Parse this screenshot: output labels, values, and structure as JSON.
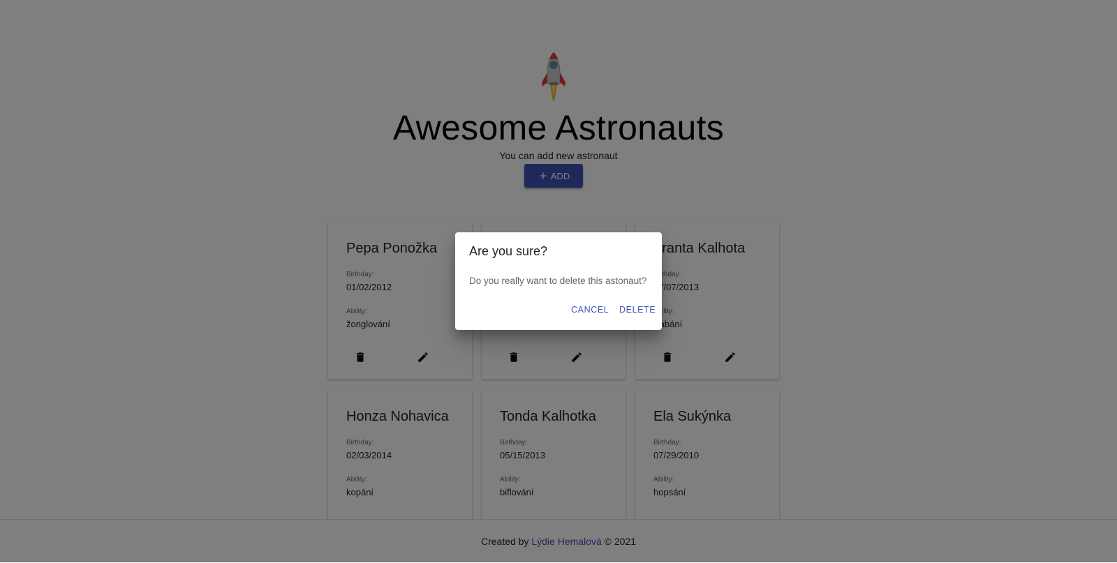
{
  "header": {
    "title": "Awesome Astronauts",
    "subtitle": "You can add new astronaut",
    "add_label": "ADD",
    "logo_icon": "rocket-icon",
    "add_icon": "plus-icon"
  },
  "astronauts": [
    {
      "name": "Pepa Ponožka",
      "birthday_label": "Birthday:",
      "birthday": "01/02/2012",
      "ability_label": "Ability:",
      "ability": "žonglování"
    },
    {
      "name": "",
      "birthday_label": "",
      "birthday": "",
      "ability_label": "",
      "ability": ""
    },
    {
      "name": "Franta Kalhota",
      "birthday_label": "Birthday:",
      "birthday": "07/07/2013",
      "ability_label": "Ability:",
      "ability": "Kabání"
    },
    {
      "name": "Honza Nohavica",
      "birthday_label": "Birthday:",
      "birthday": "02/03/2014",
      "ability_label": "Ability:",
      "ability": "kopání"
    },
    {
      "name": "Tonda Kalhotka",
      "birthday_label": "Birthday:",
      "birthday": "05/15/2013",
      "ability_label": "Ability:",
      "ability": "biflování"
    },
    {
      "name": "Ela Sukýnka",
      "birthday_label": "Birthday:",
      "birthday": "07/29/2010",
      "ability_label": "Ability:",
      "ability": "hopsání"
    }
  ],
  "card_icons": {
    "delete": "trash-icon",
    "edit": "pencil-icon"
  },
  "footer": {
    "prefix": "Created by",
    "author": "Lýdie Hemalová",
    "suffix": "© 2021"
  },
  "dialog": {
    "title": "Are you sure?",
    "text": "Do you really want to delete this astonaut?",
    "cancel_label": "CANCEL",
    "delete_label": "DELETE"
  },
  "colors": {
    "primary": "#3f51b5",
    "backdrop": "rgba(0,0,0,0.5)"
  }
}
